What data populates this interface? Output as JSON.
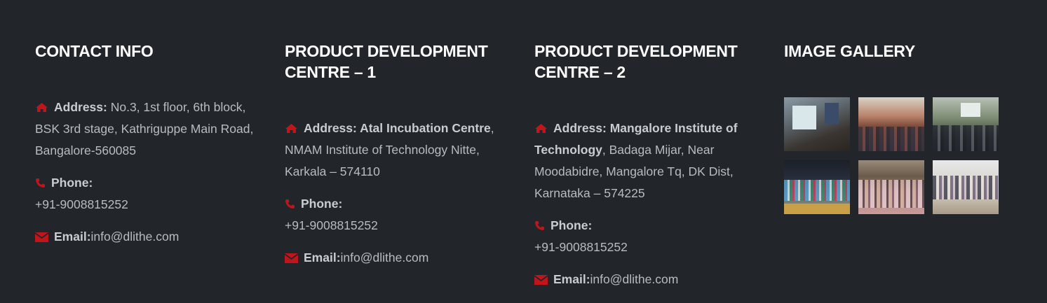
{
  "colors": {
    "background": "#22262a",
    "heading": "#ffffff",
    "text": "#b8bcc0",
    "icon": "#c0161b"
  },
  "contact": {
    "title": "CONTACT INFO",
    "address_label": "Address:",
    "address_text": " No.3, 1st floor, 6th block, BSK 3rd stage, Kathriguppe Main Road, Bangalore-560085",
    "phone_label": "Phone:",
    "phone_value": "+91-9008815252",
    "email_label": "Email:",
    "email_value": "info@dlithe.com"
  },
  "pdc1": {
    "title_line1": "PRODUCT DEVELOPMENT",
    "title_line2": "CENTRE – 1",
    "address_label": "Address: Atal Incubation Centre",
    "address_text": ", NMAM Institute of Technology Nitte, Karkala – 574110",
    "phone_label": "Phone:",
    "phone_value": "+91-9008815252",
    "email_label": "Email:",
    "email_value": "info@dlithe.com"
  },
  "pdc2": {
    "title_line1": "PRODUCT DEVELOPMENT",
    "title_line2": "CENTRE – 2",
    "address_label": "Address: Mangalore Institute of Technology",
    "address_text": ", Badaga Mijar, Near Moodabidre, Mangalore Tq, DK Dist, Karnataka – 574225",
    "phone_label": "Phone:",
    "phone_value": "+91-9008815252",
    "email_label": "Email:",
    "email_value": "info@dlithe.com"
  },
  "gallery": {
    "title": "IMAGE GALLERY",
    "images": [
      "classroom-presentation",
      "students-seated-hall",
      "classroom-lecture",
      "group-photo-stage",
      "group-photo-students",
      "group-photo-staff"
    ]
  },
  "icons": {
    "address": "home-icon",
    "phone": "phone-icon",
    "email": "envelope-icon"
  }
}
